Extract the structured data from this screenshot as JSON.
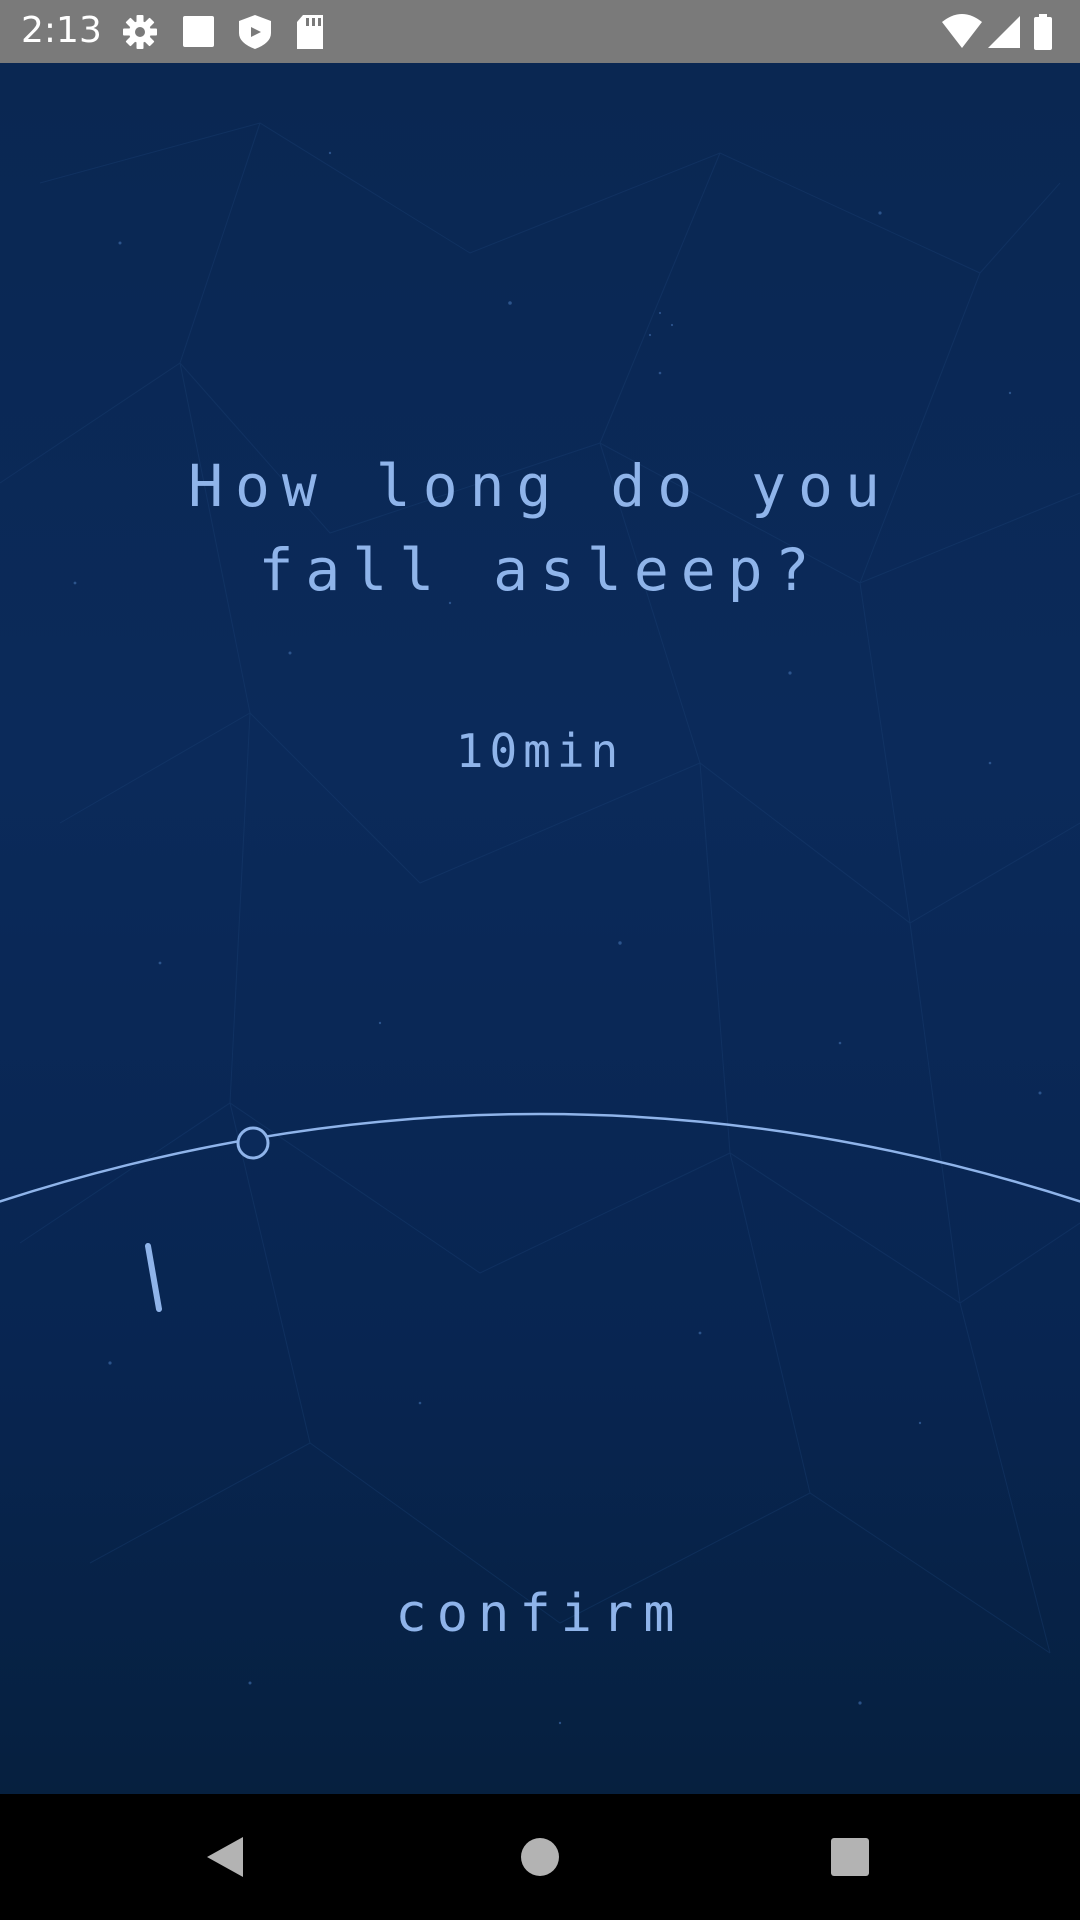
{
  "status_bar": {
    "time": "2:13",
    "left_icons": [
      "gear-icon",
      "stop-icon",
      "shield-icon",
      "sd-card-icon"
    ],
    "right_icons": [
      "wifi-icon",
      "signal-icon",
      "battery-icon"
    ]
  },
  "question": {
    "line1": "How long do you",
    "line2": "fall asleep?"
  },
  "selected_value": "10min",
  "dial": {
    "value_fraction": 0.1
  },
  "confirm_label": "confirm",
  "colors": {
    "accent": "#8fb4ea",
    "background": "#0a2752"
  },
  "nav_bar": {
    "buttons": [
      "back-icon",
      "home-icon",
      "recents-icon"
    ]
  }
}
